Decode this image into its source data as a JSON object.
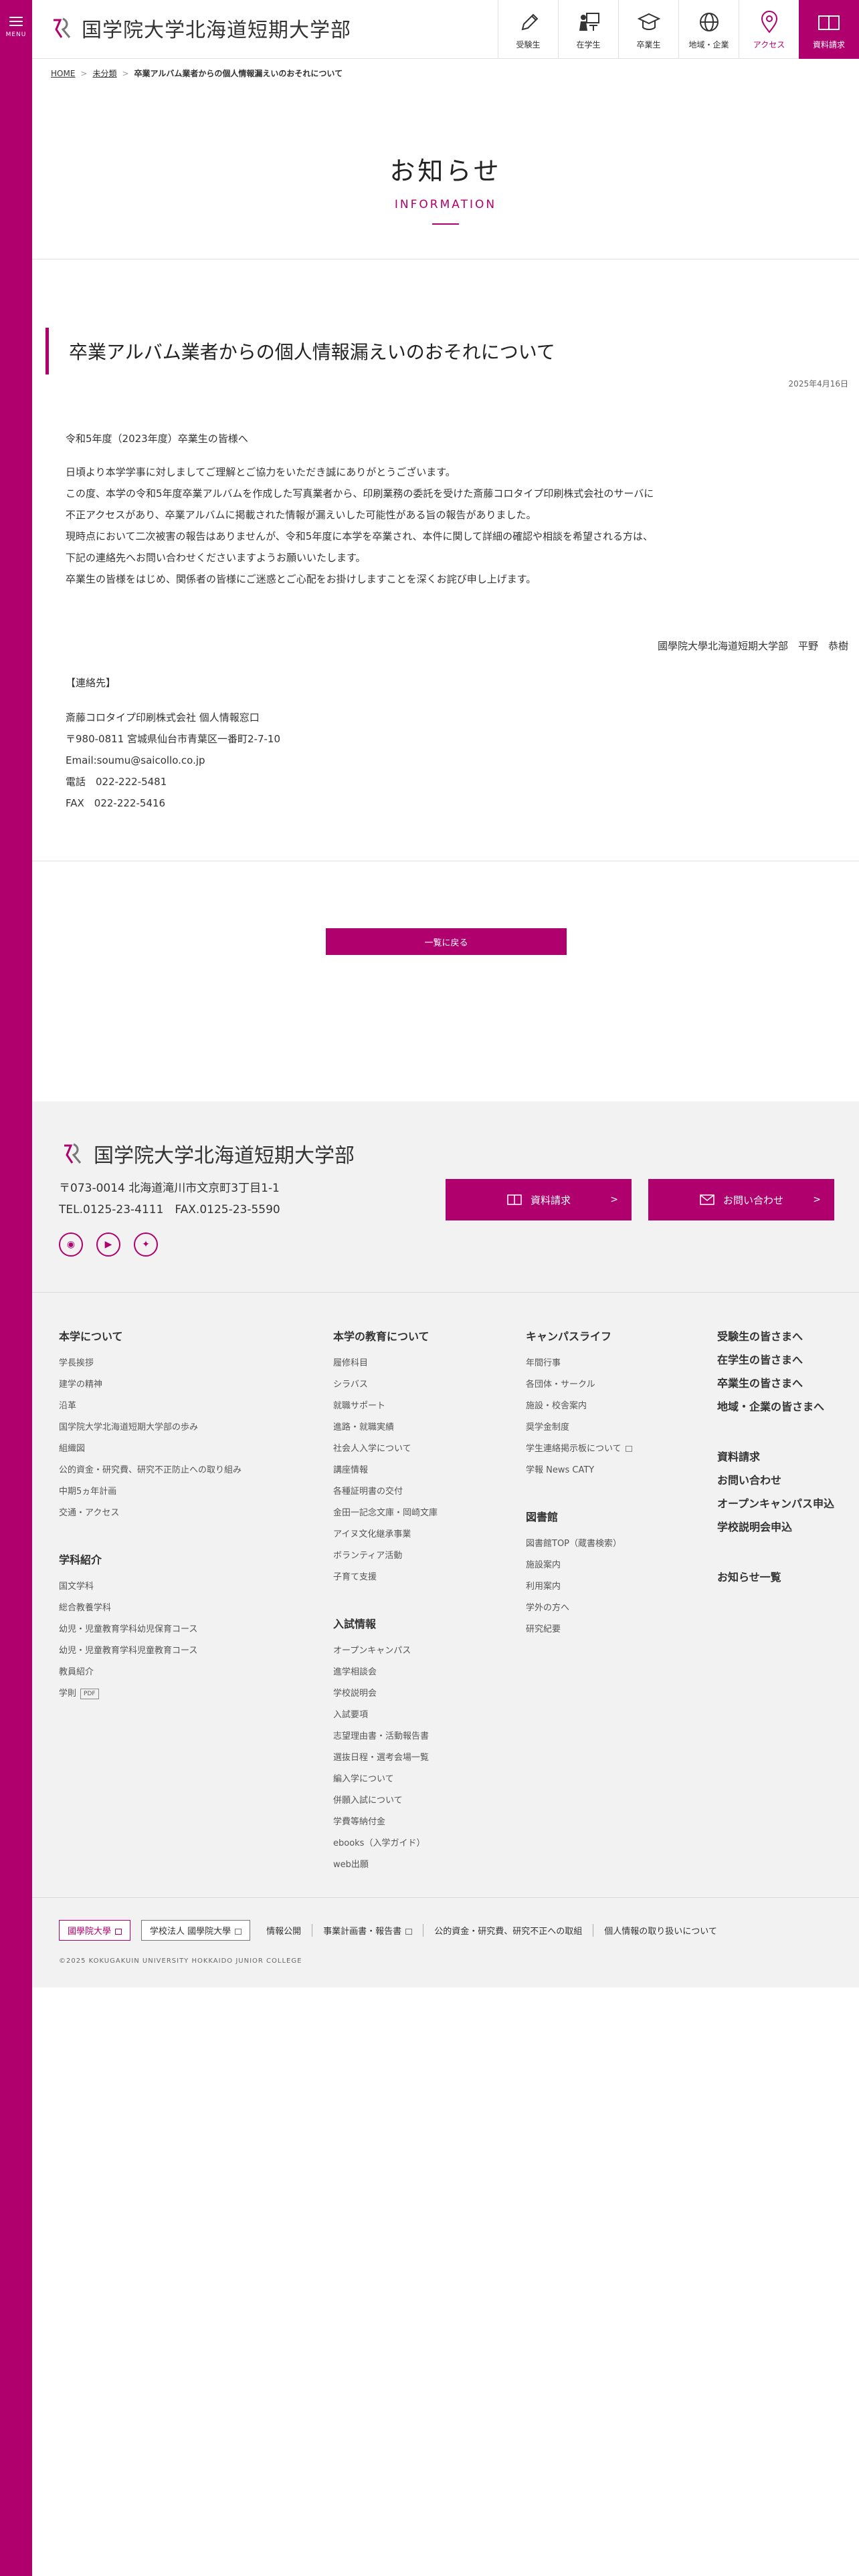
{
  "menu": {
    "label": "MENU"
  },
  "site": {
    "name": "国学院大学北海道短期大学部"
  },
  "nav": [
    {
      "label": "受験生",
      "icon": "pencil-icon"
    },
    {
      "label": "在学生",
      "icon": "student-icon"
    },
    {
      "label": "卒業生",
      "icon": "graduation-cap-icon"
    },
    {
      "label": "地域・企業",
      "icon": "globe-icon"
    },
    {
      "label": "アクセス",
      "icon": "location-pin-icon"
    },
    {
      "label": "資料請求",
      "icon": "book-icon"
    }
  ],
  "breadcrumb": {
    "home": "HOME",
    "category": "未分類",
    "current": "卒業アルバム業者からの個人情報漏えいのおそれについて"
  },
  "page": {
    "title_jp": "お知らせ",
    "title_en": "INFORMATION"
  },
  "article": {
    "title": "卒業アルバム業者からの個人情報漏えいのおそれについて",
    "date": "2025年4月16日",
    "greeting": "令和5年度（2023年度）卒業生の皆様へ",
    "body": [
      "日頃より本学学事に対しましてご理解とご協力をいただき誠にありがとうございます。",
      "この度、本学の令和5年度卒業アルバムを作成した写真業者から、印刷業務の委託を受けた斎藤コロタイプ印刷株式会社のサーバに",
      "不正アクセスがあり、卒業アルバムに掲載された情報が漏えいした可能性がある旨の報告がありました。",
      "現時点において二次被害の報告はありませんが、令和5年度に本学を卒業され、本件に関して詳細の確認や相談を希望される方は、",
      "下記の連絡先へお問い合わせくださいますようお願いいたします。",
      "卒業生の皆様をはじめ、関係者の皆様にご迷惑とご心配をお掛けしますことを深くお詫び申し上げます。"
    ],
    "signature": "國學院大學北海道短期大学部　平野　恭樹",
    "contact_heading": "【連絡先】",
    "contact": [
      "斎藤コロタイプ印刷株式会社 個人情報窓口",
      "〒980-0811 宮城県仙台市青葉区一番町2-7-10",
      "Email:soumu@saicollo.co.jp",
      "電話　022-222-5481",
      "FAX　022-222-5416"
    ],
    "back_button": "一覧に戻る"
  },
  "footer": {
    "name": "国学院大学北海道短期大学部",
    "address": "〒073-0014 北海道滝川市文京町3丁目1-1",
    "tel": "TEL.0125-23-4111　FAX.0125-23-5590",
    "request_button": "資料請求",
    "contact_button": "お問い合わせ",
    "arrow": ">",
    "col1": {
      "about_heading": "本学について",
      "about": [
        "学長挨拶",
        "建学の精神",
        "沿革",
        "国学院大学北海道短期大学部の歩み",
        "組織図",
        "公的資金・研究費、研究不正防止への取り組み",
        "中期5ヵ年計画",
        "交通・アクセス"
      ],
      "dept_heading": "学科紹介",
      "dept": [
        "国文学科",
        "総合教養学科",
        "幼児・児童教育学科幼児保育コース",
        "幼児・児童教育学科児童教育コース",
        "教員紹介",
        "学則"
      ],
      "pdf": "PDF"
    },
    "col2": {
      "edu_heading": "本学の教育について",
      "edu": [
        "履修科目",
        "シラバス",
        "就職サポート",
        "進路・就職実績",
        "社会人入学について",
        "講座情報",
        "各種証明書の交付",
        "金田一記念文庫・岡崎文庫",
        "アイヌ文化継承事業",
        "ボランティア活動",
        "子育て支援"
      ],
      "exam_heading": "入試情報",
      "exam": [
        "オープンキャンパス",
        "進学相談会",
        "学校説明会",
        "入試要項",
        "志望理由書・活動報告書",
        "選抜日程・選考会場一覧",
        "編入学について",
        "併願入試について",
        "学費等納付金",
        "ebooks（入学ガイド）",
        "web出願"
      ]
    },
    "col3": {
      "campus_heading": "キャンパスライフ",
      "campus": [
        "年間行事",
        "各団体・サークル",
        "施設・校舎案内",
        "奨学金制度",
        "学生連絡掲示板について",
        "学報 News CATY"
      ],
      "lib_heading": "図書館",
      "lib": [
        "図書館TOP（蔵書検索）",
        "施設案内",
        "利用案内",
        "学外の方へ",
        "研究紀要"
      ]
    },
    "col4": {
      "a": [
        "受験生の皆さまへ",
        "在学生の皆さまへ",
        "卒業生の皆さまへ",
        "地域・企業の皆さまへ"
      ],
      "b": [
        "資料請求",
        "お問い合わせ",
        "オープンキャンパス申込",
        "学校説明会申込"
      ],
      "c": [
        "お知らせ一覧"
      ]
    },
    "bottom_links": [
      "國學院大學",
      "学校法人 國學院大學",
      "情報公開",
      "事業計画書・報告書",
      "公的資金・研究費、研究不正への取組",
      "個人情報の取り扱いについて"
    ],
    "copyright": "©2025 KOKUGAKUIN UNIVERSITY HOKKAIDO JUNIOR COLLEGE"
  },
  "colors": {
    "accent": "#b0006e"
  }
}
